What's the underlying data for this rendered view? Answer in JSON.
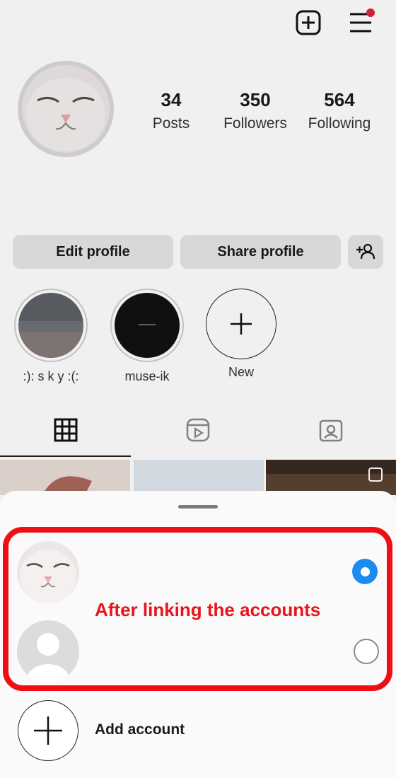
{
  "stats": [
    {
      "value": "34",
      "label": "Posts"
    },
    {
      "value": "350",
      "label": "Followers"
    },
    {
      "value": "564",
      "label": "Following"
    }
  ],
  "buttons": {
    "edit_profile": "Edit profile",
    "share_profile": "Share profile"
  },
  "highlights": [
    {
      "label": ":):  s  k  y  :(:"
    },
    {
      "label": "muse-ik"
    },
    {
      "label": "New"
    }
  ],
  "account_switcher": {
    "annotation": "After linking the accounts",
    "add_account": "Add account",
    "selected_index": 0
  },
  "colors": {
    "annotation_red": "#ee0e14",
    "radio_blue": "#1a8cf0",
    "notification_dot": "#e0243a"
  },
  "icons": [
    "new-post-icon",
    "menu-icon",
    "add-person-icon",
    "grid-icon",
    "reels-icon",
    "tagged-icon",
    "plus-icon"
  ]
}
